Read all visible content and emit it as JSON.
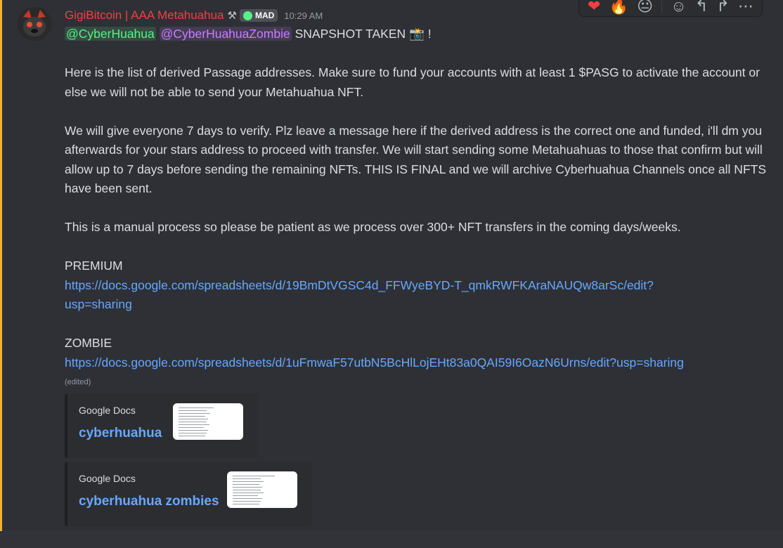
{
  "author": {
    "name": "GigiBitcoin | AAA Metahuahua",
    "role_icon": "⚒",
    "tag": "MAD",
    "timestamp": "10:29 AM"
  },
  "message": {
    "mention1": "@CyberHuahua",
    "mention2": "@CyberHuahuaZombie",
    "line1_rest": "SNAPSHOT TAKEN",
    "line1_emoji": "📸",
    "line1_end": "!",
    "para1": "Here is the list of derived Passage addresses. Make sure to fund your accounts with at least 1 $PASG to activate the account or else we will not be able to send your Metahuahua NFT.",
    "para2": "We will give everyone 7 days to verify. Plz leave a message here if the derived address is the correct one and funded, i'll dm you afterwards for your stars address to proceed with transfer. We will start sending some Metahuahuas to those that confirm but will allow up to 7 days before sending the remaining NFTs. THIS IS FINAL and we will archive Cyberhuahua Channels once all NFTS have been sent.",
    "para3": "This is a manual process so please be patient as we process over 300+ NFT transfers in the coming days/weeks.",
    "premium_label": "PREMIUM",
    "premium_url_1": "https://docs.google.com/spreadsheets/d/19BmDtVGSC4d_FFWyeBYD-T_qmkRWFKAraNAUQw8arSc/edit?",
    "premium_url_2": "usp=sharing",
    "zombie_label": "ZOMBIE",
    "zombie_url": "https://docs.google.com/spreadsheets/d/1uFmwaF57utbN5BcHlLojEHt83a0QAI59I6OazN6Urns/edit?usp=sharing",
    "edited": "(edited)"
  },
  "embeds": [
    {
      "provider": "Google Docs",
      "title": "cyberhuahua"
    },
    {
      "provider": "Google Docs",
      "title": "cyberhuahua zombies"
    }
  ],
  "toolbar": {
    "reactions": [
      "heart-emoji",
      "fire-emoji",
      "face-emoji"
    ],
    "reaction_glyphs": [
      "❤",
      "🔥",
      "😐"
    ],
    "actions": [
      "add-reaction-icon",
      "reply-icon",
      "forward-icon",
      "more-icon"
    ],
    "action_glyphs": [
      "☺",
      "↰",
      "↱",
      "⋯"
    ]
  },
  "colors": {
    "username": "#f23f43",
    "link": "#66a8ff",
    "highlight_border": "#f0b232"
  }
}
